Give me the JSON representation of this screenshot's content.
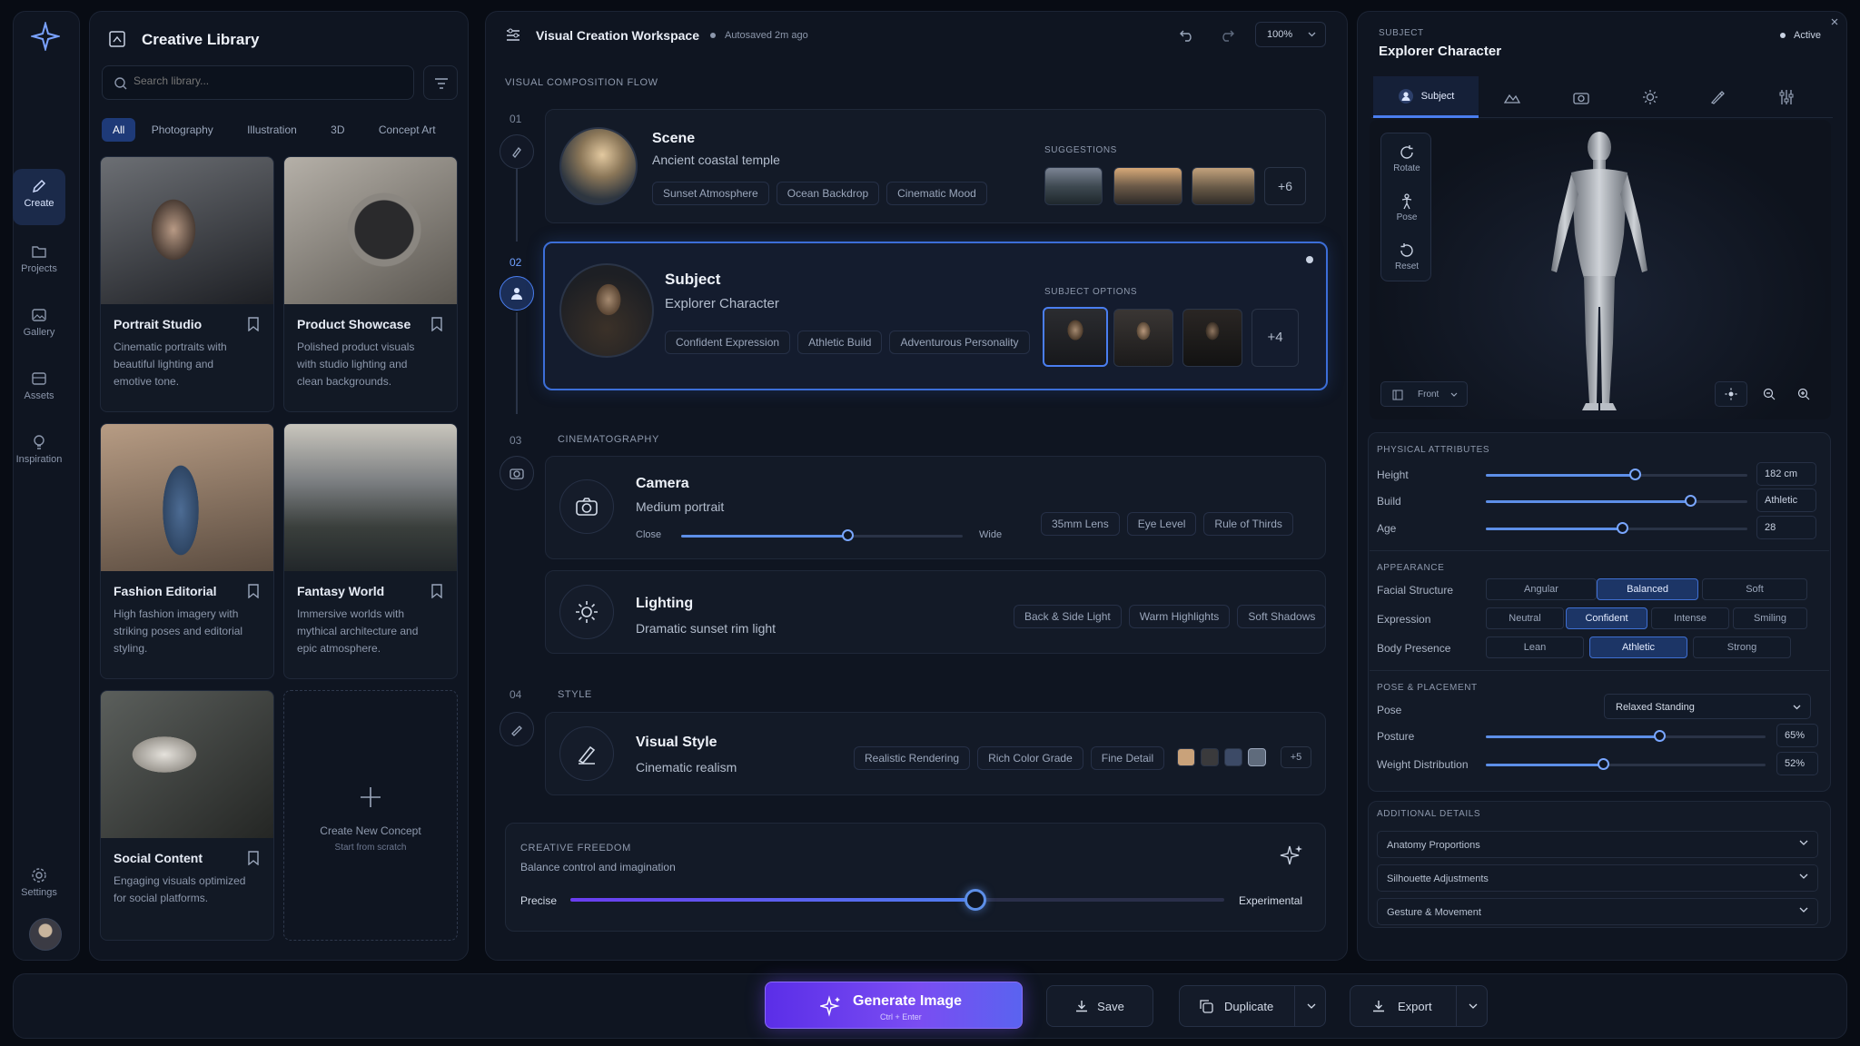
{
  "nav": {
    "items": [
      {
        "label": "Create"
      },
      {
        "label": "Projects"
      },
      {
        "label": "Gallery"
      },
      {
        "label": "Assets"
      },
      {
        "label": "Inspiration"
      }
    ],
    "settings_label": "Settings"
  },
  "library": {
    "title": "Creative Library",
    "search_placeholder": "Search library...",
    "filters": [
      "All",
      "Photography",
      "Illustration",
      "3D",
      "Concept Art"
    ],
    "cards": [
      {
        "title": "Portrait Studio",
        "desc": "Cinematic portraits with beautiful lighting and emotive tone."
      },
      {
        "title": "Product Showcase",
        "desc": "Polished product visuals with studio lighting and clean backgrounds."
      },
      {
        "title": "Fashion Editorial",
        "desc": "High fashion imagery with striking poses and editorial styling."
      },
      {
        "title": "Fantasy World",
        "desc": "Immersive worlds with mythical architecture and epic atmosphere."
      },
      {
        "title": "Social Content",
        "desc": "Engaging visuals optimized for social platforms."
      }
    ],
    "new_concept": {
      "title": "Create New Concept",
      "subtitle": "Start from scratch"
    }
  },
  "workspace": {
    "title": "Visual Creation Workspace",
    "autosave": "Autosaved 2m ago",
    "zoom": "100%",
    "flow_label": "VISUAL COMPOSITION FLOW",
    "steps": [
      "01",
      "02",
      "03",
      "04"
    ],
    "scene": {
      "title": "Scene",
      "subtitle": "Ancient coastal temple",
      "tags": [
        "Sunset Atmosphere",
        "Ocean Backdrop",
        "Cinematic Mood"
      ],
      "suggestions_label": "SUGGESTIONS",
      "more": "+6"
    },
    "subject": {
      "title": "Subject",
      "subtitle": "Explorer Character",
      "tags": [
        "Confident Expression",
        "Athletic Build",
        "Adventurous Personality"
      ],
      "options_label": "SUBJECT OPTIONS",
      "more": "+4"
    },
    "cinematography_label": "CINEMATOGRAPHY",
    "camera": {
      "title": "Camera",
      "subtitle": "Medium portrait",
      "range_min": "Close",
      "range_max": "Wide",
      "value": 0.59,
      "tags": [
        "35mm Lens",
        "Eye Level",
        "Rule of Thirds"
      ]
    },
    "lighting": {
      "title": "Lighting",
      "subtitle": "Dramatic sunset rim light",
      "tags": [
        "Back & Side Light",
        "Warm Highlights",
        "Soft Shadows"
      ]
    },
    "style_label": "STYLE",
    "visual_style": {
      "title": "Visual Style",
      "subtitle": "Cinematic realism",
      "tags": [
        "Realistic Rendering",
        "Rich Color Grade",
        "Fine Detail"
      ],
      "swatches": [
        "#c9a27a",
        "#3a3a3c",
        "#3c4a66",
        "#5f6b7c"
      ],
      "more": "+5"
    },
    "freedom": {
      "label": "CREATIVE FREEDOM",
      "subtitle": "Balance control and imagination",
      "min": "Precise",
      "max": "Experimental",
      "value": 0.62
    }
  },
  "inspector": {
    "section": "SUBJECT",
    "title": "Explorer Character",
    "status": "Active",
    "tab_active": "Subject",
    "viewer_tools": [
      "Rotate",
      "Pose",
      "Reset"
    ],
    "view": "Front",
    "physical_label": "PHYSICAL ATTRIBUTES",
    "physical": [
      {
        "label": "Height",
        "value": "182 cm",
        "level": 0.57
      },
      {
        "label": "Build",
        "value": "Athletic",
        "level": 0.78
      },
      {
        "label": "Age",
        "value": "28",
        "level": 0.52
      }
    ],
    "appearance_label": "APPEARANCE",
    "appearance": [
      {
        "label": "Facial Structure",
        "options": [
          "Angular",
          "Balanced",
          "Soft"
        ],
        "selected": 1
      },
      {
        "label": "Expression",
        "options": [
          "Neutral",
          "Confident",
          "Intense",
          "Smiling"
        ],
        "selected": 1
      },
      {
        "label": "Body Presence",
        "options": [
          "Lean",
          "Athletic",
          "Strong"
        ],
        "selected": 1
      }
    ],
    "pose_label": "POSE & PLACEMENT",
    "pose": {
      "label": "Pose",
      "value": "Relaxed Standing"
    },
    "posture": {
      "label": "Posture",
      "value": "65%",
      "level": 0.62
    },
    "weight": {
      "label": "Weight Distribution",
      "value": "52%",
      "level": 0.42
    },
    "additional_label": "ADDITIONAL DETAILS",
    "additional": [
      "Anatomy Proportions",
      "Silhouette Adjustments",
      "Gesture & Movement"
    ]
  },
  "actions": {
    "generate": "Generate Image",
    "generate_hint": "Ctrl + Enter",
    "save": "Save",
    "duplicate": "Duplicate",
    "export": "Export"
  },
  "colors": {
    "accent": "#6d3bf0",
    "selection": "#3f6fd1",
    "slider": "#5d8fe8"
  }
}
